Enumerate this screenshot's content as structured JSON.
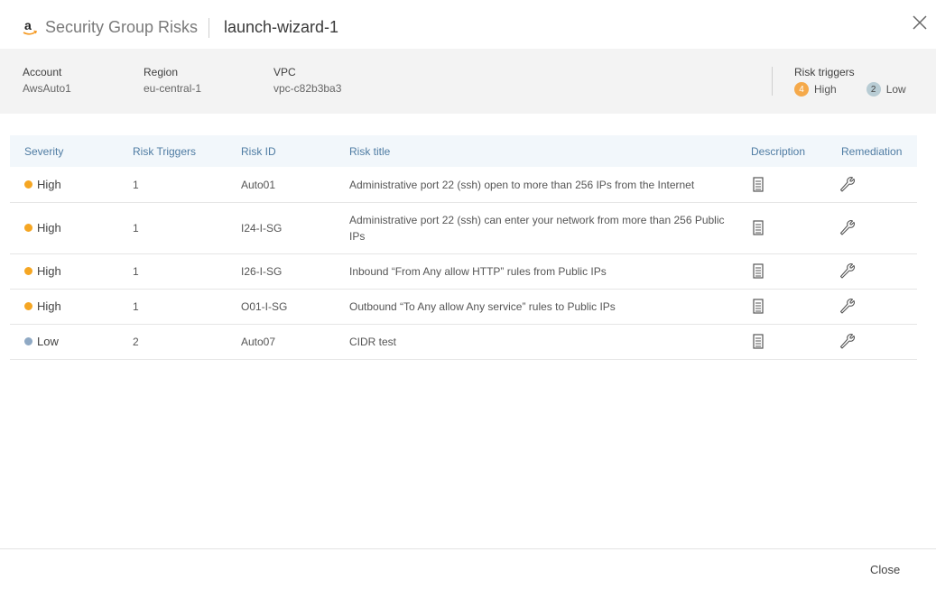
{
  "header": {
    "logo_icon": "amazon-logo-icon",
    "title": "Security Group Risks",
    "subtitle": "launch-wizard-1",
    "close_icon": "close-icon"
  },
  "info": {
    "account_label": "Account",
    "account_value": "AwsAuto1",
    "region_label": "Region",
    "region_value": "eu-central-1",
    "vpc_label": "VPC",
    "vpc_value": "vpc-c82b3ba3",
    "risk_triggers_label": "Risk triggers",
    "high_count": "4",
    "high_label": "High",
    "low_count": "2",
    "low_label": "Low"
  },
  "table": {
    "columns": [
      "Severity",
      "Risk Triggers",
      "Risk ID",
      "Risk title",
      "Description",
      "Remediation"
    ],
    "rows": [
      {
        "severity": "High",
        "severity_color": "#f5a623",
        "triggers": "1",
        "risk_id": "Auto01",
        "title": "Administrative port 22 (ssh) open to more than 256 IPs from the Internet",
        "description_icon": "document-icon",
        "remediation_icon": "wrench-icon"
      },
      {
        "severity": "High",
        "severity_color": "#f5a623",
        "triggers": "1",
        "risk_id": "I24-I-SG",
        "title": "Administrative port 22 (ssh) can enter your network from more than 256 Public IPs",
        "description_icon": "document-icon",
        "remediation_icon": "wrench-icon"
      },
      {
        "severity": "High",
        "severity_color": "#f5a623",
        "triggers": "1",
        "risk_id": "I26-I-SG",
        "title": "Inbound “From Any allow HTTP” rules from Public IPs",
        "description_icon": "document-icon",
        "remediation_icon": "wrench-icon"
      },
      {
        "severity": "High",
        "severity_color": "#f5a623",
        "triggers": "1",
        "risk_id": "O01-I-SG",
        "title": "Outbound “To Any allow Any service” rules to Public IPs",
        "description_icon": "document-icon",
        "remediation_icon": "wrench-icon"
      },
      {
        "severity": "Low",
        "severity_color": "#8fa9c4",
        "triggers": "2",
        "risk_id": "Auto07",
        "title": "CIDR test",
        "description_icon": "document-icon",
        "remediation_icon": "wrench-icon"
      }
    ]
  },
  "footer": {
    "close_label": "Close"
  }
}
